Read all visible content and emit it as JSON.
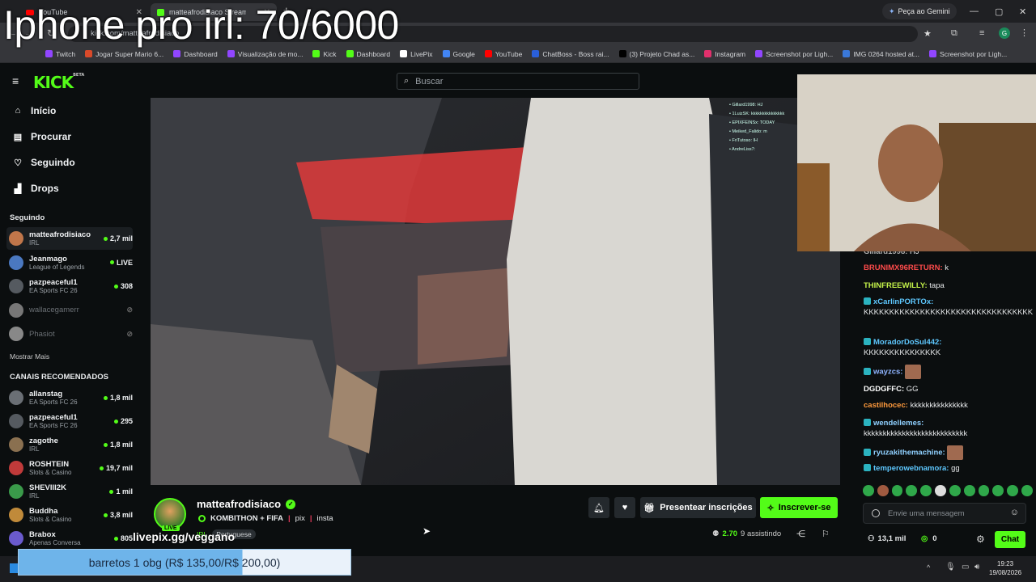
{
  "overlay": {
    "title": "Iphone pro irl: 70/6000"
  },
  "browser": {
    "tabs": [
      {
        "label": "YouTube",
        "color": "#ff0000"
      },
      {
        "label": "matteafrodisiaco Stream",
        "color": "#53fc18"
      }
    ],
    "gemini_label": "Peça ao Gemini",
    "url": "kick.com/matteafrodisiaco",
    "bookmarks": [
      {
        "label": "Twitch",
        "color": "#9146ff"
      },
      {
        "label": "Jogar Super Mario 6...",
        "color": "#d94a2a"
      },
      {
        "label": "Dashboard",
        "color": "#9146ff"
      },
      {
        "label": "Visualização de mo...",
        "color": "#9146ff"
      },
      {
        "label": "Kick",
        "color": "#53fc18"
      },
      {
        "label": "Dashboard",
        "color": "#53fc18"
      },
      {
        "label": "LivePix",
        "color": "#ffffff"
      },
      {
        "label": "Google",
        "color": "#4285f4"
      },
      {
        "label": "YouTube",
        "color": "#ff0000"
      },
      {
        "label": "ChatBoss - Boss rai...",
        "color": "#2a5fd9"
      },
      {
        "label": "(3) Projeto Chad as...",
        "color": "#000000"
      },
      {
        "label": "Instagram",
        "color": "#e1306c"
      },
      {
        "label": "Screenshot por Ligh...",
        "color": "#9146ff"
      },
      {
        "label": "IMG 0264 hosted at...",
        "color": "#3a78d8"
      },
      {
        "label": "Screenshot por Ligh...",
        "color": "#9146ff"
      }
    ]
  },
  "kick": {
    "logo": "KICK",
    "logo_beta": "BETA",
    "search_placeholder": "Buscar",
    "nav": [
      {
        "label": "Início",
        "icon": "home-icon"
      },
      {
        "label": "Procurar",
        "icon": "browse-icon"
      },
      {
        "label": "Seguindo",
        "icon": "heart-icon"
      },
      {
        "label": "Drops",
        "icon": "drops-icon"
      }
    ],
    "following_title": "Seguindo",
    "following": [
      {
        "name": "matteafrodisiaco",
        "category": "IRL",
        "viewers": "2,7 mil",
        "live": true,
        "color": "#c0764a"
      },
      {
        "name": "Jeanmago",
        "category": "League of Legends",
        "viewers": "LIVE",
        "live": true,
        "color": "#4a78c0"
      },
      {
        "name": "pazpeaceful1",
        "category": "EA Sports FC 26",
        "viewers": "308",
        "live": true,
        "color": "#555a60"
      },
      {
        "name": "wallacegamerr",
        "category": "",
        "viewers": "",
        "live": false,
        "color": "#777"
      },
      {
        "name": "Phasiot",
        "category": "",
        "viewers": "",
        "live": false,
        "color": "#888"
      }
    ],
    "show_more": "Mostrar Mais",
    "recommended_title": "CANAIS RECOMENDADOS",
    "recommended": [
      {
        "name": "allanstag",
        "category": "EA Sports FC 26",
        "viewers": "1,8 mil",
        "color": "#6a6f75"
      },
      {
        "name": "pazpeaceful1",
        "category": "EA Sports FC 26",
        "viewers": "295",
        "color": "#555a60"
      },
      {
        "name": "zagothe",
        "category": "IRL",
        "viewers": "1,8 mil",
        "color": "#8a7050"
      },
      {
        "name": "ROSHTEIN",
        "category": "Slots & Casino",
        "viewers": "19,7 mil",
        "color": "#c03a3a"
      },
      {
        "name": "SHEVIII2K",
        "category": "IRL",
        "viewers": "1 mil",
        "color": "#3a9a4a"
      },
      {
        "name": "Buddha",
        "category": "Slots & Casino",
        "viewers": "3,8 mil",
        "color": "#c08a3a"
      },
      {
        "name": "Brabox",
        "category": "Apenas Conversa",
        "viewers": "805",
        "color": "#6a5acd"
      }
    ],
    "stream": {
      "streamer": "matteafrodisiaco",
      "live_badge": "LIVE",
      "title": "KOMBITHON + FIFA",
      "links": [
        "pix",
        "insta"
      ],
      "category": "IRL",
      "language": "Portuguese",
      "livepix": "livepix.gg/veggano",
      "gift_label": "Presentear inscrições",
      "subscribe_label": "Inscrever-se",
      "viewers_count": "2.70",
      "viewers_suffix": "9 assistindo"
    },
    "chat": {
      "messages": [
        {
          "user": "Gillard1998:",
          "text": "HJ",
          "color": "#b0b0b0",
          "badge": false
        },
        {
          "user": "BRUNIMX96RETURN:",
          "text": "k",
          "color": "#ff4b4b",
          "badge": false
        },
        {
          "user": "THINFREEWILLY:",
          "text": "tapa",
          "color": "#c4f24a",
          "badge": false
        },
        {
          "user": "xCarlinPORTOx:",
          "text": "KKKKKKKKKKKKKKKKKKKKKKKKKKKKKKKKK",
          "color": "#5ec8ff",
          "badge": true
        },
        {
          "user": "MoradorDoSul442:",
          "text": "KKKKKKKKKKKKKKK",
          "color": "#5ec8ff",
          "badge": true
        },
        {
          "user": "wayzcs:",
          "text": "",
          "color": "#8fb4ff",
          "badge": true
        },
        {
          "user": "DGDGFFC:",
          "text": "GG",
          "color": "#ffffff",
          "badge": false
        },
        {
          "user": "castilhocec:",
          "text": "kkkkkkkkkkkkkkk",
          "color": "#ff9a3c",
          "badge": false
        },
        {
          "user": "wendellemes:",
          "text": "kkkkkkkkkkkkkkkkkkkkkkkkkkk",
          "color": "#8fd0ff",
          "badge": true
        },
        {
          "user": "ryuzakithemachine:",
          "text": "",
          "color": "#8fd0ff",
          "badge": true
        },
        {
          "user": "temperowebnamora:",
          "text": "gg",
          "color": "#5ec8ff",
          "badge": true
        }
      ],
      "input_placeholder": "Envie uma mensagem",
      "points": "13,1 mil",
      "kcoins": "0",
      "chat_button": "Chat"
    }
  },
  "donation": {
    "text": "barretos 1 obg (R$ 135,00/R$ 200,00)",
    "progress": 0.675
  },
  "clock": {
    "time": "19:23",
    "date": "19/08/2026"
  }
}
